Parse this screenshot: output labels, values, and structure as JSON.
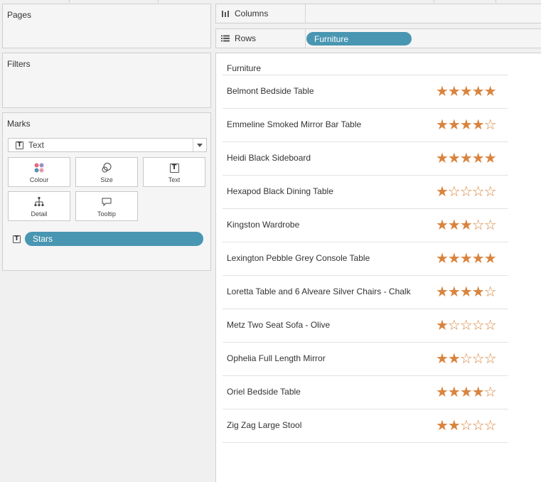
{
  "pages": {
    "title": "Pages"
  },
  "filters": {
    "title": "Filters"
  },
  "marks": {
    "title": "Marks",
    "mark_type": "Text",
    "cards": {
      "colour": "Colour",
      "size": "Size",
      "text": "Text",
      "detail": "Detail",
      "tooltip": "Tooltip"
    },
    "text_field": "Stars"
  },
  "columns": {
    "label": "Columns"
  },
  "rows": {
    "label": "Rows",
    "pill": "Furniture"
  },
  "view": {
    "column_header": "Furniture",
    "rows": [
      {
        "name": "Belmont Bedside Table",
        "stars": "★★★★★",
        "rating": 5
      },
      {
        "name": "Emmeline Smoked Mirror Bar Table",
        "stars": "★★★★☆",
        "rating": 4
      },
      {
        "name": "Heidi Black Sideboard",
        "stars": "★★★★★",
        "rating": 5
      },
      {
        "name": "Hexapod Black Dining Table",
        "stars": "★☆☆☆☆",
        "rating": 1
      },
      {
        "name": "Kingston Wardrobe",
        "stars": "★★★☆☆",
        "rating": 3
      },
      {
        "name": "Lexington Pebble Grey Console Table",
        "stars": "★★★★★",
        "rating": 5
      },
      {
        "name": "Loretta Table and 6 Alveare Silver Chairs - Chalk",
        "stars": "★★★★☆",
        "rating": 4
      },
      {
        "name": "Metz Two Seat Sofa - Olive",
        "stars": "★☆☆☆☆",
        "rating": 1
      },
      {
        "name": "Ophelia Full Length Mirror",
        "stars": "★★☆☆☆",
        "rating": 2
      },
      {
        "name": "Oriel Bedside Table",
        "stars": "★★★★☆",
        "rating": 4
      },
      {
        "name": "Zig Zag Large Stool",
        "stars": "★★☆☆☆",
        "rating": 2
      }
    ]
  },
  "colors": {
    "pill": "#4996b2",
    "star": "#d9843e"
  }
}
